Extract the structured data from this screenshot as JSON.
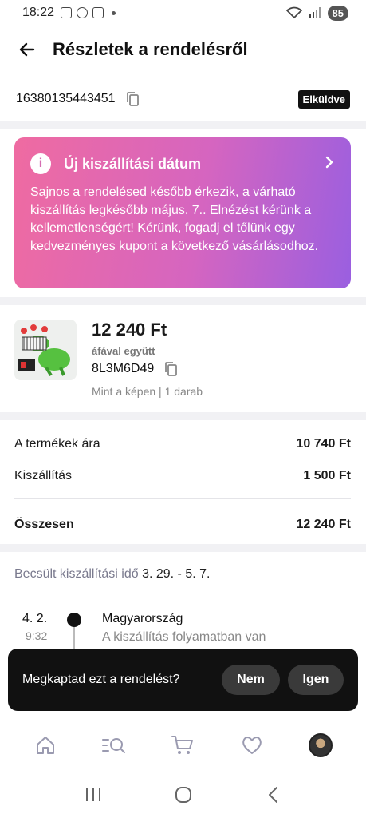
{
  "status_bar": {
    "time": "18:22",
    "battery": "85"
  },
  "header": {
    "title": "Részletek a rendelésről"
  },
  "order": {
    "id": "16380135443451",
    "status": "Elküldve"
  },
  "notice": {
    "title": "Új kiszállítási dátum",
    "text": "Sajnos a rendelésed később érkezik, a várható kiszállítás legkésőbb május. 7.. Elnézést kérünk a kellemetlenségért! Kérünk, fogadj el tőlünk egy kedvezményes kupont a következő vásárlásodhoz."
  },
  "product": {
    "price": "12 240 Ft",
    "vat_note": "áfával együtt",
    "sku": "8L3M6D49",
    "variant": "Mint a képen | 1 darab"
  },
  "summary": {
    "items_label": "A termékek ára",
    "items_value": "10 740 Ft",
    "shipping_label": "Kiszállítás",
    "shipping_value": "1 500 Ft",
    "total_label": "Összesen",
    "total_value": "12 240 Ft"
  },
  "delivery": {
    "estimate_label": "Becsült kiszállítási idő",
    "estimate_dates": "3. 29. - 5. 7.",
    "event_date": "4. 2.",
    "event_time": "9:32",
    "event_place": "Magyarország",
    "event_desc": "A kiszállítás folyamatban van"
  },
  "snackbar": {
    "question": "Megkaptad ezt a rendelést?",
    "no_label": "Nem",
    "yes_label": "Igen"
  },
  "icons": {
    "back": "arrow-left-icon",
    "copy": "copy-icon",
    "info": "info-icon",
    "chevron": "chevron-right-icon",
    "nav": [
      "home-icon",
      "search-icon",
      "cart-icon",
      "heart-icon",
      "avatar"
    ]
  },
  "colors": {
    "notice_gradient_start": "#ef6ba1",
    "notice_gradient_end": "#9a5fe0",
    "badge_bg": "#111111",
    "snackbar_bg": "#111111"
  }
}
